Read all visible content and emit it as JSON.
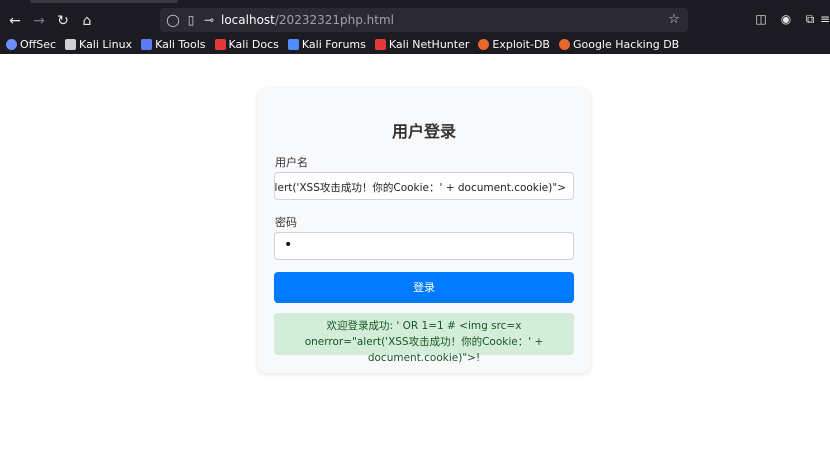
{
  "browser": {
    "url_host": "localhost",
    "url_path": "/20232321php.html",
    "bookmarks": [
      {
        "label": "OffSec",
        "icon": "offsec-icon",
        "color": "#6f8cff"
      },
      {
        "label": "Kali Linux",
        "icon": "kali-dragon-icon",
        "color": "#d0d0d0"
      },
      {
        "label": "Kali Tools",
        "icon": "kali-tools-icon",
        "color": "#5b7bff"
      },
      {
        "label": "Kali Docs",
        "icon": "kali-docs-icon",
        "color": "#e23a3a"
      },
      {
        "label": "Kali Forums",
        "icon": "kali-forums-icon",
        "color": "#4f8cff"
      },
      {
        "label": "Kali NetHunter",
        "icon": "kali-nethunter-icon",
        "color": "#e23a3a"
      },
      {
        "label": "Exploit-DB",
        "icon": "exploit-db-icon",
        "color": "#e8682a"
      },
      {
        "label": "Google Hacking DB",
        "icon": "ghdb-icon",
        "color": "#e8682a"
      }
    ]
  },
  "login": {
    "title": "用户登录",
    "username_label": "用户名",
    "username_value": "=\"alert('XSS攻击成功！你的Cookie：' + document.cookie)\">",
    "password_label": "密码",
    "password_value": "•",
    "submit_label": "登录",
    "alert_text": "欢迎登录成功: ' OR 1=1 # <img src=x onerror=\"alert('XSS攻击成功！你的Cookie：' + document.cookie)\">!"
  },
  "colors": {
    "primary": "#007bff",
    "success_bg": "#d4edda",
    "success_text": "#155724"
  }
}
